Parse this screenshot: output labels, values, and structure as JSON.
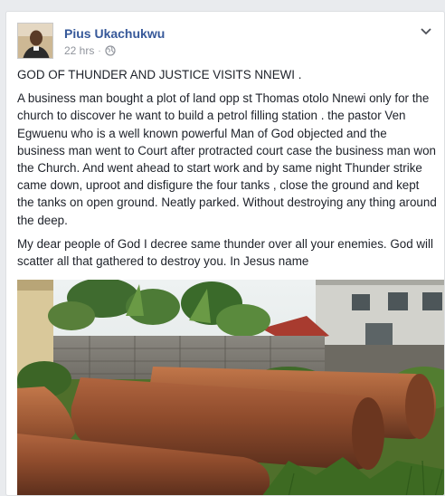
{
  "post": {
    "author_name": "Pius Ukachukwu",
    "timestamp": "22 hrs",
    "separator": "·",
    "privacy_icon": "globe-icon",
    "more_icon": "chevron-down-icon",
    "paragraphs": [
      "GOD OF THUNDER AND JUSTICE VISITS NNEWI .",
      "A business man bought a plot of land opp st Thomas otolo Nnewi only for the church to discover he want to build a petrol filling station . the pastor Ven Egwuenu who is a well known powerful Man of God objected and the business man went to Court after protracted court case the business man won the Church. And went ahead to start work and by same night Thunder strike came down, uproot and disfigure the four tanks , close the ground and kept the tanks on open ground. Neatly parked. Without destroying any thing around the deep.",
      "My dear people of God I decree same thunder over all your enemies. God will scatter all that gathered to destroy you. In Jesus name"
    ],
    "colors": {
      "author_link": "#365899",
      "meta_text": "#90949c",
      "body_text": "#1d2129",
      "card_border": "#dddfe2",
      "page_bg": "#e9ebee"
    }
  }
}
